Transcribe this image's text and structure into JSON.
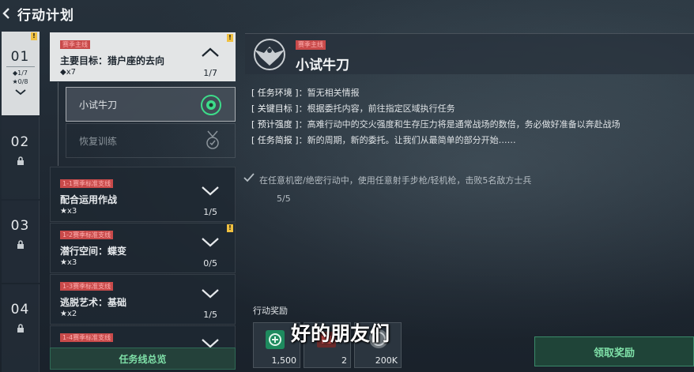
{
  "header": {
    "title": "行动计划"
  },
  "chapters": [
    {
      "num": "01",
      "stat1": "◆1/7",
      "stat2": "★0/8",
      "badge": "!"
    },
    {
      "num": "02"
    },
    {
      "num": "03"
    },
    {
      "num": "04"
    }
  ],
  "missions": {
    "main": {
      "tag": "赛季主线",
      "name": "主要目标：猎户座的去向",
      "star": "◆x7",
      "count": "1/7",
      "badge": "!"
    },
    "subs": [
      {
        "label": "小试牛刀"
      },
      {
        "label": "恢复训练"
      }
    ],
    "items": [
      {
        "tag": "1-1赛季标准支线",
        "name": "配合运用作战",
        "star": "★x3",
        "count": "1/5"
      },
      {
        "tag": "1-2赛季标准支线",
        "name": "潜行空间：蝶变",
        "star": "★x3",
        "count": "0/5",
        "badge": "!"
      },
      {
        "tag": "1-3赛季标准支线",
        "name": "逃脱艺术：基础",
        "star": "★x2",
        "count": "1/5"
      },
      {
        "tag": "1-4赛季标准支线"
      }
    ],
    "overview_label": "任务线总览"
  },
  "detail": {
    "tag": "赛季主线",
    "title": "小试牛刀",
    "rows": [
      {
        "key": "[ 任务环境 ]",
        "value": "：暂无相关情报"
      },
      {
        "key": "[ 关键目标 ]",
        "value": "：根据委托内容，前往指定区域执行任务"
      },
      {
        "key": "[ 预计强度 ]",
        "value": "：高难行动中的交火强度和生存压力将是通常战场的数倍，务必做好准备以奔赴战场"
      },
      {
        "key": "[ 任务简报 ]",
        "value": "：新的周期，新的委托。让我们从最简单的部分开始……"
      }
    ],
    "objective": "在任意机密/绝密行动中，使用任意射手步枪/轻机枪，击败5名敌方士兵",
    "progress": "5/5",
    "reward_label": "行动奖励",
    "rewards": [
      {
        "amount": "1,500",
        "icon": "currency-icon"
      },
      {
        "amount": "2",
        "icon": "card-icon"
      },
      {
        "amount": "200K",
        "icon": "coin-icon"
      }
    ],
    "claim_label": "领取奖励"
  },
  "subtitle": "好的朋友们"
}
